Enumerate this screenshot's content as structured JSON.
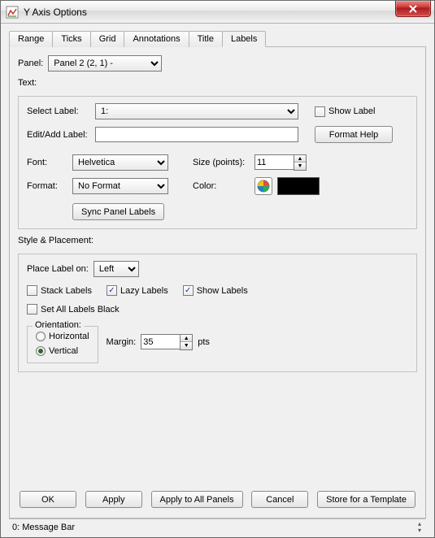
{
  "window": {
    "title": "Y Axis Options"
  },
  "tabs": [
    "Range",
    "Ticks",
    "Grid",
    "Annotations",
    "Title",
    "Labels"
  ],
  "activeTab": "Labels",
  "panel": {
    "label": "Panel:",
    "value": "Panel 2 (2, 1)  -"
  },
  "text": {
    "legend": "Text:",
    "selectLabel": {
      "label": "Select Label:",
      "value": "1:"
    },
    "showLabel": {
      "label": "Show Label",
      "checked": false
    },
    "editLabel": {
      "label": "Edit/Add Label:",
      "value": ""
    },
    "formatHelp": "Format Help",
    "font": {
      "label": "Font:",
      "value": "Helvetica"
    },
    "size": {
      "label": "Size (points):",
      "value": "11"
    },
    "format": {
      "label": "Format:",
      "value": "No Format"
    },
    "color": {
      "label": "Color:",
      "swatch": "#000000"
    },
    "syncBtn": "Sync Panel Labels"
  },
  "style": {
    "legend": "Style & Placement:",
    "placeLabel": {
      "label": "Place Label on:",
      "value": "Left"
    },
    "stackLabels": {
      "label": "Stack Labels",
      "checked": false
    },
    "lazyLabels": {
      "label": "Lazy Labels",
      "checked": true
    },
    "showLabels": {
      "label": "Show Labels",
      "checked": true
    },
    "setBlack": {
      "label": "Set All Labels Black",
      "checked": false
    },
    "orientation": {
      "legend": "Orientation:",
      "horizontal": "Horizontal",
      "vertical": "Vertical",
      "value": "Vertical"
    },
    "margin": {
      "label": "Margin:",
      "value": "35",
      "unit": "pts"
    }
  },
  "buttons": {
    "ok": "OK",
    "apply": "Apply",
    "applyAll": "Apply to All Panels",
    "cancel": "Cancel",
    "store": "Store for a Template"
  },
  "messageBar": "0: Message Bar"
}
